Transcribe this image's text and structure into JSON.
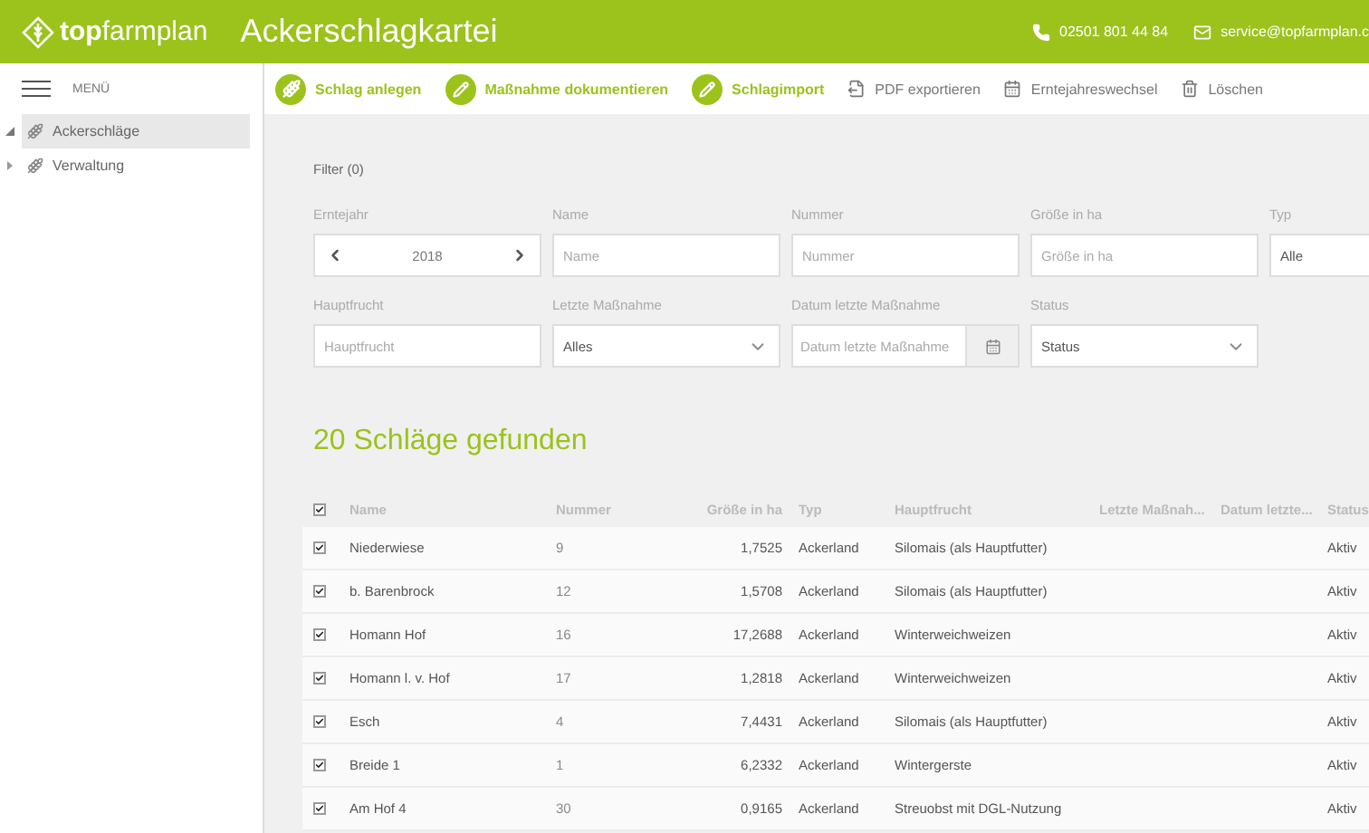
{
  "header": {
    "logo_bold": "top",
    "logo_light": "farmplan",
    "title": "Ackerschlagkartei",
    "phone": "02501 801 44 84",
    "email": "service@topfarmplan.c"
  },
  "menu_label": "MENÜ",
  "toolbar": [
    {
      "kind": "primary",
      "label": "Schlag anlegen"
    },
    {
      "kind": "primary",
      "label": "Maßnahme dokumentieren"
    },
    {
      "kind": "primary",
      "label": "Schlagimport"
    },
    {
      "kind": "secondary",
      "label": "PDF exportieren"
    },
    {
      "kind": "secondary",
      "label": "Erntejahreswechsel"
    },
    {
      "kind": "secondary",
      "label": "Löschen"
    }
  ],
  "sidebar": {
    "items": [
      {
        "label": "Ackerschläge",
        "selected": true,
        "expanded": true
      },
      {
        "label": "Verwaltung",
        "selected": false,
        "expanded": false
      }
    ]
  },
  "filter": {
    "title": "Filter (0)",
    "fields": [
      {
        "kind": "stepper",
        "label": "Erntejahr",
        "value": "2018"
      },
      {
        "kind": "text",
        "label": "Name",
        "placeholder": "Name"
      },
      {
        "kind": "text",
        "label": "Nummer",
        "placeholder": "Nummer"
      },
      {
        "kind": "text",
        "label": "Größe in ha",
        "placeholder": "Größe in ha"
      },
      {
        "kind": "wide",
        "label": "Typ",
        "value": "Alle"
      },
      {
        "kind": "text",
        "label": "Hauptfrucht",
        "placeholder": "Hauptfrucht"
      },
      {
        "kind": "select",
        "label": "Letzte Maßnahme",
        "value": "Alles"
      },
      {
        "kind": "date",
        "label": "Datum letzte Maßnahme",
        "placeholder": "Datum letzte Maßnahme"
      },
      {
        "kind": "select",
        "label": "Status",
        "value": "Status"
      }
    ]
  },
  "result_title": "20 Schläge gefunden",
  "table": {
    "all_checked": true,
    "columns": [
      "Name",
      "Nummer",
      "Größe in ha",
      "Typ",
      "Hauptfrucht",
      "Letzte Maßnah...",
      "Datum letzte...",
      "Status"
    ],
    "rows": [
      {
        "checked": true,
        "cells": [
          "Niederwiese",
          "9",
          "1,7525",
          "Ackerland",
          "Silomais (als Hauptfutter)",
          "",
          "",
          "Aktiv"
        ]
      },
      {
        "checked": true,
        "cells": [
          "b. Barenbrock",
          "12",
          "1,5708",
          "Ackerland",
          "Silomais (als Hauptfutter)",
          "",
          "",
          "Aktiv"
        ]
      },
      {
        "checked": true,
        "cells": [
          "Homann Hof",
          "16",
          "17,2688",
          "Ackerland",
          "Winterweichweizen",
          "",
          "",
          "Aktiv"
        ]
      },
      {
        "checked": true,
        "cells": [
          "Homann l. v. Hof",
          "17",
          "1,2818",
          "Ackerland",
          "Winterweichweizen",
          "",
          "",
          "Aktiv"
        ]
      },
      {
        "checked": true,
        "cells": [
          "Esch",
          "4",
          "7,4431",
          "Ackerland",
          "Silomais (als Hauptfutter)",
          "",
          "",
          "Aktiv"
        ]
      },
      {
        "checked": true,
        "cells": [
          "Breide 1",
          "1",
          "6,2332",
          "Ackerland",
          "Wintergerste",
          "",
          "",
          "Aktiv"
        ]
      },
      {
        "checked": true,
        "cells": [
          "Am Hof 4",
          "30",
          "0,9165",
          "Ackerland",
          "Streuobst mit DGL-Nutzung",
          "",
          "",
          "Aktiv"
        ]
      }
    ]
  }
}
